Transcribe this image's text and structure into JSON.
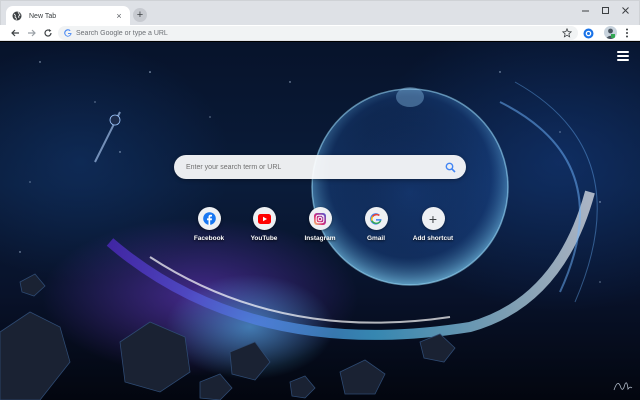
{
  "browser": {
    "tab": {
      "title": "New Tab",
      "close_glyph": "×",
      "favicon": "globe-icon"
    },
    "new_tab_glyph": "+",
    "window_controls": [
      "minimize-icon",
      "maximize-icon",
      "close-icon"
    ],
    "nav": [
      "back-arrow-icon",
      "forward-arrow-icon",
      "reload-icon"
    ],
    "omnibox": {
      "placeholder": "Search Google or type a URL",
      "value": "",
      "icon": "google-g-icon"
    },
    "toolbar_icons": [
      "star-icon",
      "extension-icon",
      "profile-avatar",
      "more-vert-icon"
    ]
  },
  "page": {
    "menu_icon": "hamburger-menu-icon",
    "search": {
      "placeholder": "Enter your search term or URL",
      "value": "",
      "icon": "search-icon"
    },
    "shortcuts": [
      {
        "label": "Facebook",
        "icon": "facebook-icon"
      },
      {
        "label": "YouTube",
        "icon": "youtube-icon"
      },
      {
        "label": "Instagram",
        "icon": "instagram-icon"
      },
      {
        "label": "Gmail",
        "icon": "google-g-icon"
      },
      {
        "label": "Add shortcut",
        "icon": "plus-icon",
        "glyph": "+"
      }
    ],
    "background": "space-wormhole-wallpaper"
  },
  "colors": {
    "tabstrip": "#dee1e6",
    "omnibox": "#f1f3f4",
    "facebook": "#1877f2",
    "youtube": "#ff0000",
    "instagram": "#d62976",
    "search_icon": "#4285f4"
  }
}
